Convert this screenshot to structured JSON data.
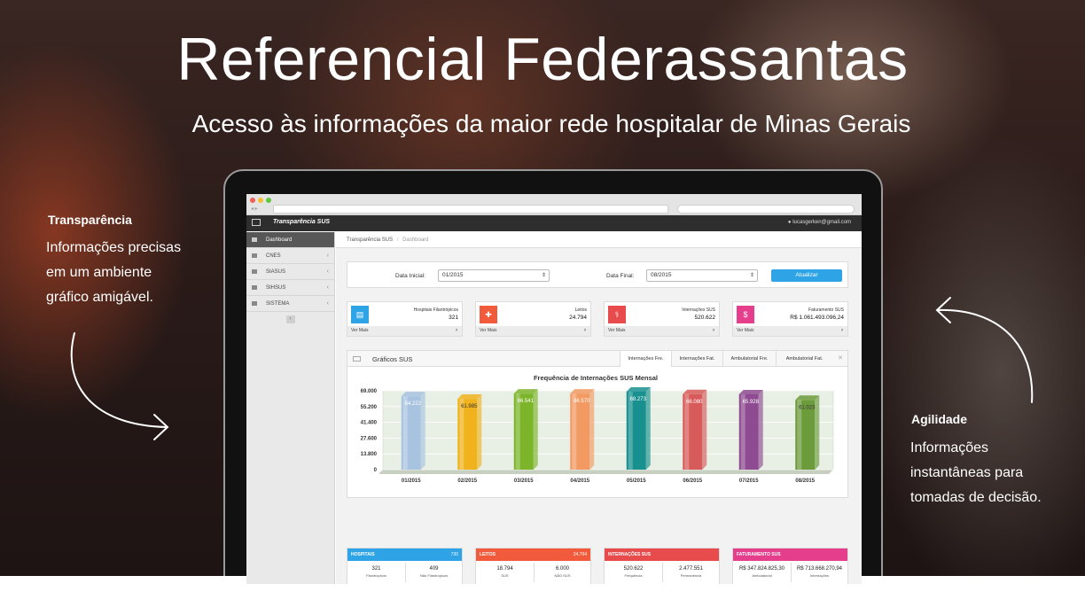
{
  "hero": {
    "title": "Referencial Federassantas",
    "subtitle": "Acesso às informações da maior rede hospitalar de Minas Gerais"
  },
  "left_feature": {
    "heading": "Transparência",
    "lines": [
      "Informações precisas",
      "em um ambiente",
      "gráfico amigável."
    ]
  },
  "right_feature": {
    "heading": "Agilidade",
    "lines": [
      "Informações",
      "instantâneas para",
      "tomadas de decisão."
    ]
  },
  "app": {
    "brand": "Transparência SUS",
    "user": "lucasgerken@gmail.com",
    "sidebar": [
      {
        "label": "Dashboard",
        "active": true
      },
      {
        "label": "CNES",
        "active": false
      },
      {
        "label": "SIASUS",
        "active": false
      },
      {
        "label": "SIHSUS",
        "active": false
      },
      {
        "label": "SISTEMA",
        "active": false
      }
    ],
    "breadcrumb": {
      "root": "Transparência SUS",
      "separator": "/",
      "current": "Dashboard"
    },
    "filter": {
      "start_label": "Data Inicial:",
      "start_value": "01/2015",
      "end_label": "Data Final:",
      "end_value": "08/2015",
      "button": "Atualizar"
    },
    "stats": [
      {
        "label": "Hospitais Filantrópicos",
        "value": "321",
        "more": "Ver Mais",
        "color": "#2ea4e6",
        "icon": "clipboard-icon"
      },
      {
        "label": "Leitos",
        "value": "24.794",
        "more": "Ver Mais",
        "color": "#f15a3a",
        "icon": "medical-plus-icon"
      },
      {
        "label": "Internações SUS",
        "value": "520.622",
        "more": "Ver Mais",
        "color": "#e84b4b",
        "icon": "stethoscope-icon"
      },
      {
        "label": "Faturamento SUS",
        "value": "R$ 1.061.493.096,24",
        "more": "Ver Mais",
        "color": "#e53e8c",
        "icon": "dollar-icon"
      }
    ],
    "chart_panel": {
      "title": "Gráficos SUS",
      "tabs": [
        "Internações Fre.",
        "Internações Fat.",
        "Ambulatorial Fre.",
        "Ambulatorial Fat."
      ],
      "active_tab": 0
    },
    "bottom_cards": [
      {
        "title": "HOSPITAIS",
        "total": "730",
        "color": "#2ea4e6",
        "cols": [
          {
            "value": "321",
            "label": "Filantrópicos"
          },
          {
            "value": "409",
            "label": "Não Filantrópicos"
          }
        ]
      },
      {
        "title": "LEITOS",
        "total": "24.794",
        "color": "#f15a3a",
        "cols": [
          {
            "value": "18.794",
            "label": "SUS"
          },
          {
            "value": "6.000",
            "label": "NÃO SUS"
          }
        ]
      },
      {
        "title": "INTERNAÇÕES SUS",
        "total": "",
        "color": "#e84b4b",
        "cols": [
          {
            "value": "520.622",
            "label": "Frequência"
          },
          {
            "value": "2.477.551",
            "label": "Permanência"
          }
        ]
      },
      {
        "title": "FATURAMENTO SUS",
        "total": "",
        "color": "#e53e8c",
        "cols": [
          {
            "value": "R$ 347.824.825,30",
            "label": "Ambulatorial"
          },
          {
            "value": "R$ 713.668.270,94",
            "label": "Internações"
          }
        ]
      }
    ]
  },
  "chart_data": {
    "type": "bar",
    "title": "Frequência de Internações SUS Mensal",
    "categories": [
      "01/2015",
      "02/2015",
      "03/2015",
      "04/2015",
      "05/2015",
      "06/2015",
      "07/2015",
      "08/2015"
    ],
    "values": [
      64222,
      61985,
      66541,
      66570,
      68273,
      66080,
      65928,
      61023
    ],
    "value_labels": [
      "64.222",
      "61.985",
      "66.541",
      "66.570",
      "68.273",
      "66.080",
      "65.928",
      "61.023"
    ],
    "colors": [
      "#a8c3e0",
      "#f0b31e",
      "#7cb52a",
      "#f29a62",
      "#17908f",
      "#d85b5b",
      "#8e4b91",
      "#6c9b3c"
    ],
    "yticks": [
      "69.000",
      "55.200",
      "41.400",
      "27.600",
      "13.800",
      "0"
    ],
    "ylim": [
      0,
      69000
    ],
    "grid": true
  }
}
